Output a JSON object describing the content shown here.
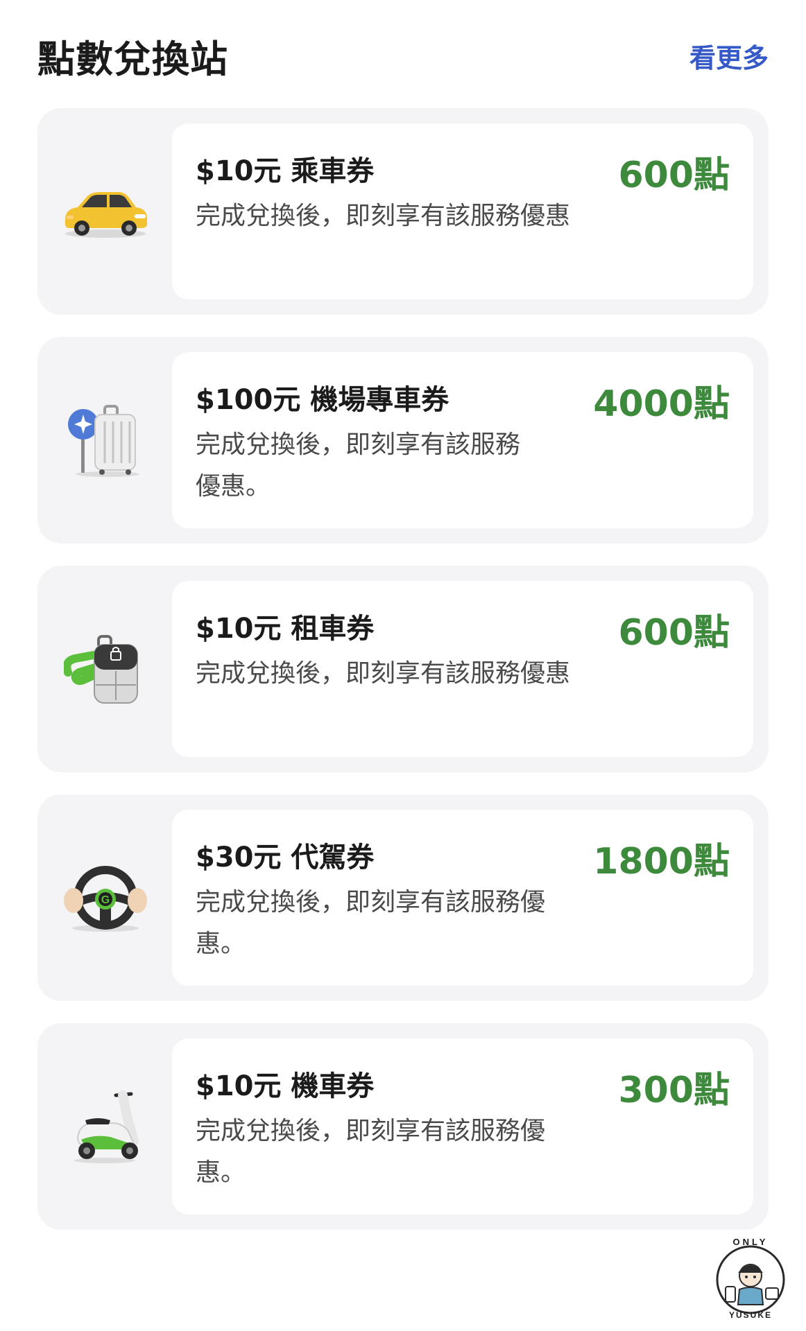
{
  "header": {
    "title": "點數兌換站",
    "see_more": "看更多"
  },
  "items": [
    {
      "title": "$10元 乘車券",
      "points": "600點",
      "description": "完成兌換後，即刻享有該服務優惠",
      "icon": "taxi-icon"
    },
    {
      "title": "$100元 機場專車券",
      "points": "4000點",
      "description": "完成兌換後，即刻享有該服務優惠。",
      "icon": "airport-luggage-icon"
    },
    {
      "title": "$10元 租車券",
      "points": "600點",
      "description": "完成兌換後，即刻享有該服務優惠",
      "icon": "car-key-icon"
    },
    {
      "title": "$30元 代駕券",
      "points": "1800點",
      "description": "完成兌換後，即刻享有該服務優惠。",
      "icon": "steering-wheel-icon"
    },
    {
      "title": "$10元 機車券",
      "points": "300點",
      "description": "完成兌換後，即刻享有該服務優惠。",
      "icon": "scooter-icon"
    }
  ],
  "watermark": {
    "top_text": "ONLY",
    "bottom_text": "YUSUKE"
  },
  "colors": {
    "points_green": "#3d8a3c",
    "link_blue": "#3559c7",
    "card_bg": "#f4f4f6",
    "taxi_yellow": "#f2c230"
  }
}
